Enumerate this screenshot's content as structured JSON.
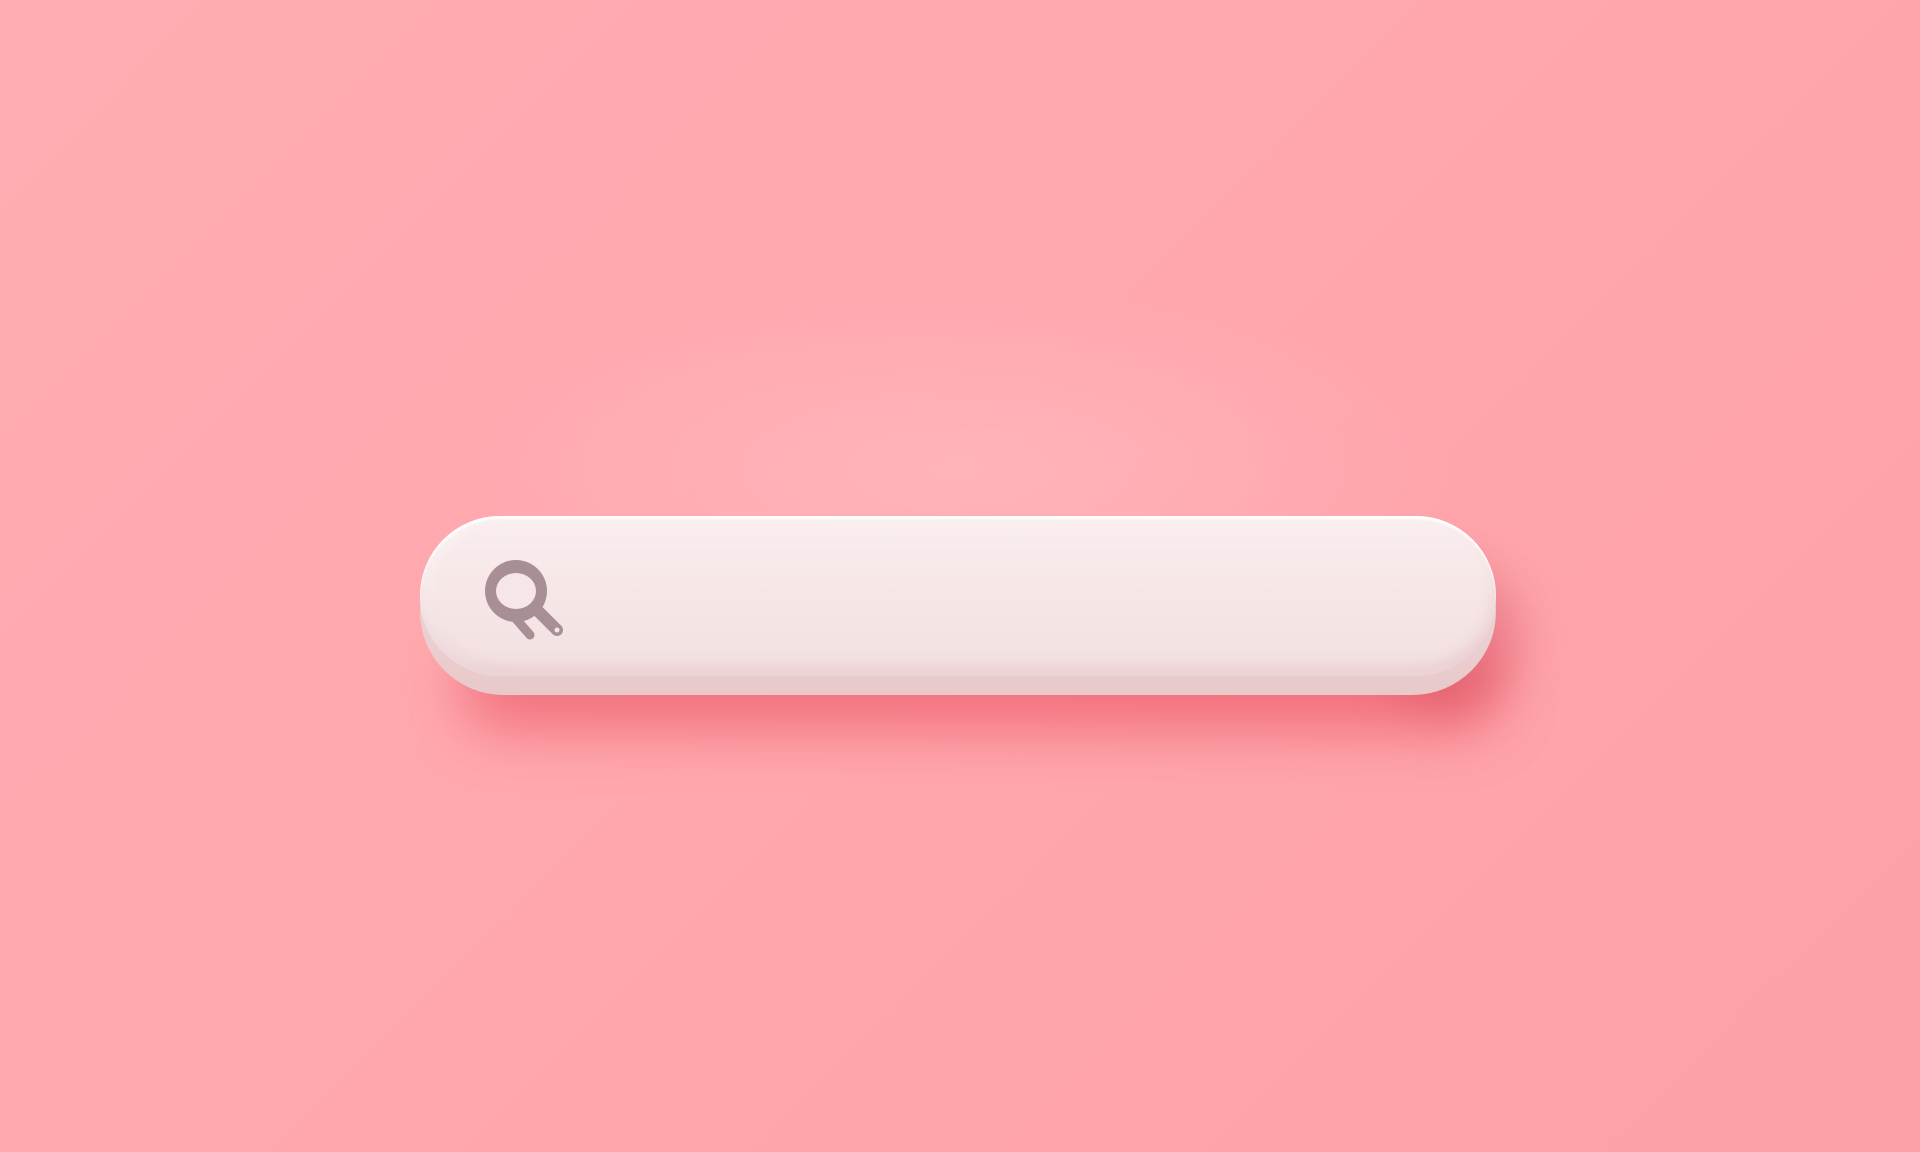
{
  "search": {
    "value": "",
    "placeholder": "",
    "icon": "search-icon"
  },
  "colors": {
    "background": "#ffa8ae",
    "bar": "#f7e6e7",
    "icon": "#a88f95"
  }
}
